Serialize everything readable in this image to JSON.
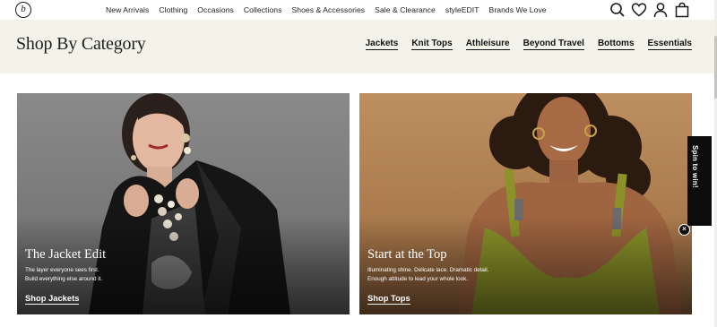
{
  "header": {
    "logo_text": "b",
    "nav": [
      "New Arrivals",
      "Clothing",
      "Occasions",
      "Collections",
      "Shoes & Accessories",
      "Sale & Clearance",
      "styleEDIT",
      "Brands We Love"
    ],
    "icons": [
      "search-icon",
      "heart-icon",
      "user-icon",
      "bag-icon"
    ]
  },
  "category_band": {
    "title": "Shop By Category",
    "links": [
      "Jackets",
      "Knit Tops",
      "Athleisure",
      "Beyond Travel",
      "Bottoms",
      "Essentials"
    ]
  },
  "tiles": [
    {
      "title": "The Jacket Edit",
      "desc_line1": "The layer everyone sees first.",
      "desc_line2": "Build everything else around it.",
      "link": "Shop Jackets"
    },
    {
      "title": "Start at the Top",
      "desc_line1": "Illuminating shine. Delicate lace. Dramatic detail.",
      "desc_line2": "Enough attitude to lead your whole look.",
      "link": "Shop Tops"
    }
  ],
  "promo": {
    "label": "Spin to win!",
    "close": "×"
  },
  "colors": {
    "band_bg": "#f4f3ea",
    "text": "#1a1a1a",
    "promo_bg": "#0c0c0c"
  }
}
